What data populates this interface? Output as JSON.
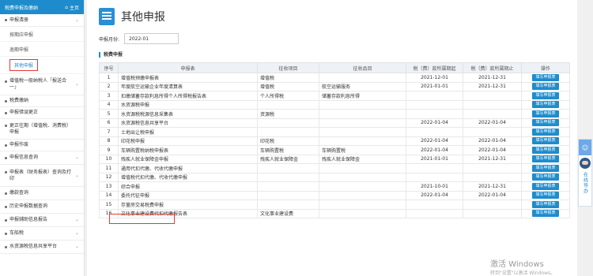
{
  "sidebar": {
    "header_title": "税费申报及缴纳",
    "home_label": "主页",
    "items": [
      {
        "label": "申报清册",
        "chevron": "v",
        "subs": [
          {
            "label": "按期应申报"
          },
          {
            "label": "逾期申报"
          },
          {
            "label": "其他申报"
          }
        ]
      },
      {
        "label": "增值税一般纳税人「报送合一」",
        "chevron": "v"
      },
      {
        "label": "税费缴纳",
        "chevron": ""
      },
      {
        "label": "申报错误更正",
        "chevron": ""
      },
      {
        "label": "更正往期（增值税、消费税）申报",
        "chevron": ""
      },
      {
        "label": "申报作废",
        "chevron": ""
      },
      {
        "label": "申报信息查询",
        "chevron": "v"
      },
      {
        "label": "申报表（财务报表）查询及打印",
        "chevron": "v"
      },
      {
        "label": "缴款查询",
        "chevron": ""
      },
      {
        "label": "历史申报数据查询",
        "chevron": ""
      },
      {
        "label": "申报辅助信息报告",
        "chevron": "v"
      },
      {
        "label": "车船税",
        "chevron": "v"
      },
      {
        "label": "水资源税信息共享平台",
        "chevron": "v"
      }
    ]
  },
  "page": {
    "title": "其他申报",
    "period_label": "申报月份:",
    "period_value": "2022-01",
    "section_label": "税费申报"
  },
  "table": {
    "headers": [
      "序号",
      "申报表",
      "征收项目",
      "征收品目",
      "税（费）款所属期起",
      "税（费）款所属期止",
      "操作"
    ],
    "action_label": "填写申报表",
    "rows": [
      {
        "no": "1",
        "form": "增值税预缴申报表",
        "item": "增值税",
        "sub": "",
        "start": "2021-12-01",
        "end": "2021-12-31"
      },
      {
        "no": "2",
        "form": "年度航空运输企业年度清算表",
        "item": "增值税",
        "sub": "航空运输服务",
        "start": "2021-01-01",
        "end": "2021-12-31"
      },
      {
        "no": "3",
        "form": "扣缴储蓄存款利息所得个人所得税报告表",
        "item": "个人所得税",
        "sub": "储蓄存款利息所得",
        "start": "",
        "end": ""
      },
      {
        "no": "4",
        "form": "水资源税申报",
        "item": "",
        "sub": "",
        "start": "",
        "end": ""
      },
      {
        "no": "5",
        "form": "水资源税税源信息采集表",
        "item": "资源税",
        "sub": "",
        "start": "",
        "end": ""
      },
      {
        "no": "6",
        "form": "水资源税信息共享平台",
        "item": "",
        "sub": "",
        "start": "2022-01-04",
        "end": "2022-01-04"
      },
      {
        "no": "7",
        "form": "土地出让税申报",
        "item": "",
        "sub": "",
        "start": "",
        "end": ""
      },
      {
        "no": "8",
        "form": "印花税申报",
        "item": "印花税",
        "sub": "",
        "start": "2022-01-04",
        "end": "2022-01-04"
      },
      {
        "no": "9",
        "form": "车辆购置税纳税申报表",
        "item": "车辆购置税",
        "sub": "车辆购置税",
        "start": "2022-01-04",
        "end": "2022-01-04"
      },
      {
        "no": "10",
        "form": "残疾人就业保障金申报",
        "item": "残疾人就业保障金",
        "sub": "残疾人就业保障金",
        "start": "2021-01-01",
        "end": "2021-12-31"
      },
      {
        "no": "11",
        "form": "通用代扣代缴、代收代缴申报",
        "item": "",
        "sub": "",
        "start": "",
        "end": ""
      },
      {
        "no": "12",
        "form": "增值税代扣代缴、代收代缴申报",
        "item": "",
        "sub": "",
        "start": "",
        "end": ""
      },
      {
        "no": "13",
        "form": "综合申报",
        "item": "",
        "sub": "",
        "start": "2021-10-01",
        "end": "2021-12-31"
      },
      {
        "no": "14",
        "form": "委托代征申报",
        "item": "",
        "sub": "",
        "start": "2022-01-04",
        "end": "2022-01-04"
      },
      {
        "no": "15",
        "form": "存量房交易税费申报",
        "item": "",
        "sub": "",
        "start": "",
        "end": ""
      },
      {
        "no": "16",
        "form": "文化事业建设费代扣代缴报告表",
        "item": "文化事业建设费",
        "sub": "",
        "start": "",
        "end": ""
      }
    ]
  },
  "float_panel": {
    "label": "在线导办"
  },
  "watermark": {
    "line1": "激活 Windows",
    "line2": "转到\"设置\"以激活 Windows。"
  }
}
